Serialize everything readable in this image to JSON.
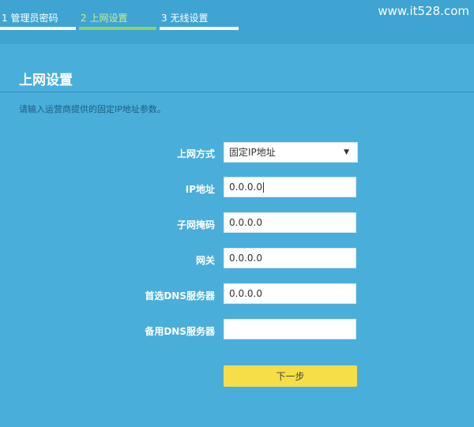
{
  "steps": [
    {
      "label": "1 管理员密码"
    },
    {
      "label": "2 上网设置"
    },
    {
      "label": "3 无线设置"
    }
  ],
  "watermark": "www.it528.com",
  "page_title": "上网设置",
  "hint": "请输入运营商提供的固定IP地址参数。",
  "form": {
    "connection_type": {
      "label": "上网方式",
      "value": "固定IP地址"
    },
    "ip": {
      "label": "IP地址",
      "value": "0.0.0.0"
    },
    "mask": {
      "label": "子网掩码",
      "value": "0.0.0.0"
    },
    "gateway": {
      "label": "网关",
      "value": "0.0.0.0"
    },
    "dns_primary": {
      "label": "首选DNS服务器",
      "value": "0.0.0.0"
    },
    "dns_secondary": {
      "label": "备用DNS服务器",
      "value": ""
    }
  },
  "next_label": "下一步",
  "colors": {
    "accent_step": "#8bd36a",
    "button": "#f6de48",
    "background": "#4aaedb"
  }
}
